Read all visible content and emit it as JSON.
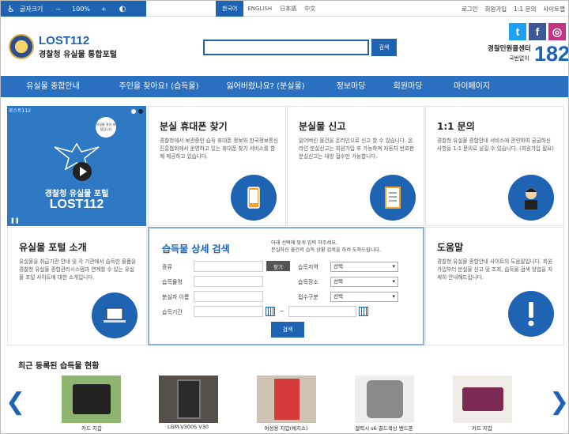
{
  "topbar": {
    "font_size_label": "글자크기",
    "zoom_minus": "−",
    "zoom_value": "100%",
    "zoom_plus": "+",
    "languages": [
      "한국어",
      "ENGLISH",
      "日本語",
      "中文"
    ],
    "util_links": [
      "로그인",
      "회원가입",
      "1:1 문의",
      "사이트맵"
    ]
  },
  "header": {
    "logo_title": "LOST112",
    "logo_subtitle": "경찰청 유실물 통합포털",
    "search_button": "검색",
    "call_center": "경찰민원콜센터",
    "call_sub": "국번없이",
    "call_number": "182",
    "social": [
      "t",
      "f",
      "◎"
    ]
  },
  "nav": [
    "유실물 종합안내",
    "주인을 찾아요! (습득물)",
    "잃어버렸나요? (분실물)",
    "정보마당",
    "회원마당",
    "마이페이지"
  ],
  "video": {
    "tag": "로스트112",
    "bubble": "유실물 관리 포털입니다",
    "title1": "경찰청 유실물 포털",
    "title2": "LOST112",
    "pause": "❚❚"
  },
  "cards": {
    "phone": {
      "title": "분실 휴대폰 찾기",
      "text": "경찰청에서 보관중인 습득 휴대폰 정보와 한국정보통신진흥협회에서 운영하고 있는 휴대폰 찾기 서비스를 함께 제공하고 있습니다."
    },
    "report": {
      "title": "분실물 신고",
      "text": "잃어버린 물건을 온라인으로 신고 할 수 있습니다. 온라인 분실신고는 회원가입 후 가능하며 자동차 번호판 분실신고는 내방 접수만 가능합니다."
    },
    "inquiry": {
      "title": "1:1 문의",
      "text": "경찰청 유실물 종합안내 서비스에 관련하여 궁금하신 사항을 1:1 문의로 남길 수 있습니다. (회원가입 필요)"
    },
    "portal": {
      "title": "유실물 포털 소개",
      "text": "유실물을 취급기관 안내 및 각 기관에서 습득한 물품을 경찰청 유실물 종합관리시스템과 연계할 수 있는 유실물 포털 사이트에 대한 소개입니다."
    },
    "help": {
      "title": "도움말",
      "text": "경찰청 유실물 종합안내 사이트의 도움말입니다. 회원가입부터 분실물 신고 및 조회, 습득물 검색 방법을 자세히 안내해드립니다."
    }
  },
  "detail_search": {
    "title": "습득물 상세 검색",
    "desc_line1": "아래 선택에 맞게 입력 하주세요.",
    "desc_line2": "분실하신 물건의 습득 상황 검색을 하려 도와드립니다.",
    "labels": {
      "category": "종류",
      "item_name": "습득물명",
      "lost_date": "분실자 이름",
      "period": "습득기간",
      "region": "습득지역",
      "place": "습득장소",
      "status": "접수구분"
    },
    "find_button": "찾기",
    "select_value": "선택",
    "tilde": "~",
    "search_button": "검색"
  },
  "recent": {
    "title": "최근 등록된 습득물 현황",
    "prev": "❮",
    "next": "❯",
    "items": [
      {
        "caption": "카드 지갑"
      },
      {
        "caption": "LGM-V300S V30"
      },
      {
        "caption": "여성용 지갑(쉐지스)"
      },
      {
        "caption": "갤럭시 s6 골드색상 밴드폰"
      },
      {
        "caption": "카드 지갑"
      }
    ]
  },
  "colors": {
    "brand_blue": "#1f63b3",
    "nav_blue": "#2b6fc0"
  }
}
